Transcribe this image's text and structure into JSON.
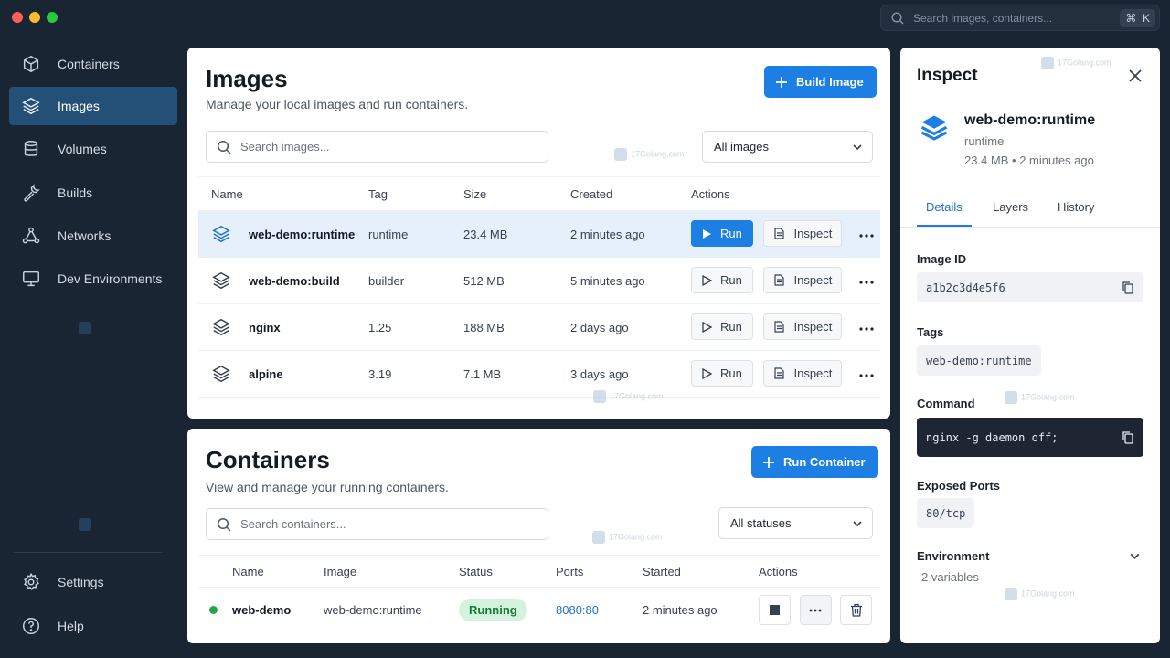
{
  "titlebar": {
    "search_placeholder": "Search images, containers...",
    "shortcut_cmd": "⌘",
    "shortcut_key": "K"
  },
  "sidebar": {
    "items": [
      {
        "label": "Containers",
        "icon": "cube-icon"
      },
      {
        "label": "Images",
        "icon": "layers-icon",
        "active": true
      },
      {
        "label": "Volumes",
        "icon": "database-icon"
      },
      {
        "label": "Builds",
        "icon": "wrench-icon"
      },
      {
        "label": "Networks",
        "icon": "network-icon"
      },
      {
        "label": "Dev Environments",
        "icon": "monitor-icon"
      }
    ],
    "bottom": [
      {
        "label": "Settings",
        "icon": "gear-icon"
      },
      {
        "label": "Help",
        "icon": "help-icon"
      }
    ]
  },
  "images": {
    "title": "Images",
    "subtitle": "Manage your local images and run containers.",
    "build_label": "Build Image",
    "search_placeholder": "Search images...",
    "filter": "All images",
    "columns": [
      "Name",
      "Tag",
      "Size",
      "Created",
      "Actions"
    ],
    "run_label": "Run",
    "inspect_label": "Inspect",
    "rows": [
      {
        "name": "web-demo:runtime",
        "tag": "runtime",
        "size": "23.4 MB",
        "created": "2 minutes ago"
      },
      {
        "name": "web-demo:build",
        "tag": "builder",
        "size": "512 MB",
        "created": "5 minutes ago"
      },
      {
        "name": "nginx",
        "tag": "1.25",
        "size": "188 MB",
        "created": "2 days ago"
      },
      {
        "name": "alpine",
        "tag": "3.19",
        "size": "7.1 MB",
        "created": "3 days ago"
      }
    ]
  },
  "containers": {
    "title": "Containers",
    "subtitle": "View and manage your running containers.",
    "run_label": "Run Container",
    "search_placeholder": "Search containers...",
    "filter": "All statuses",
    "columns": [
      "Name",
      "Image",
      "Status",
      "Ports",
      "Started",
      "Actions"
    ],
    "rows": [
      {
        "name": "web-demo",
        "image": "web-demo:runtime",
        "status": "Running",
        "ports": "8080:80",
        "started": "2 minutes ago"
      }
    ]
  },
  "inspect": {
    "title": "Inspect",
    "name": "web-demo:runtime",
    "tag": "runtime",
    "meta": "23.4 MB • 2 minutes ago",
    "tabs": [
      "Details",
      "Layers",
      "History"
    ],
    "image_id_label": "Image ID",
    "image_id": "a1b2c3d4e5f6",
    "tags_label": "Tags",
    "tag_value": "web-demo:runtime",
    "command_label": "Command",
    "command": "nginx -g daemon off;",
    "ports_label": "Exposed Ports",
    "port": "80/tcp",
    "env_label": "Environment",
    "env_sub": "2 variables"
  },
  "watermark": "17Golang.com",
  "colors": {
    "accent": "#1d7fe3",
    "sidebar_bg": "#1a2533",
    "active_nav": "#245077",
    "running": "#22a64a"
  }
}
